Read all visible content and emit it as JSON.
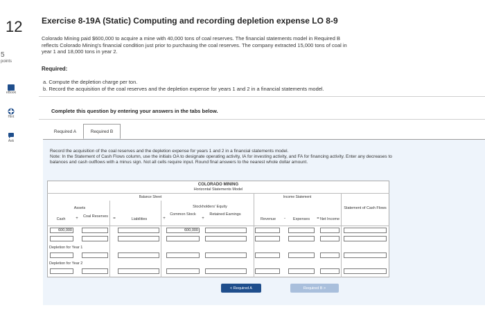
{
  "question": {
    "number": "12",
    "points_value": "5",
    "points_label": "points"
  },
  "sidebar": [
    {
      "label": "eBook",
      "icon": "book-icon"
    },
    {
      "label": "Hint",
      "icon": "hint-icon"
    },
    {
      "label": "Ask",
      "icon": "chat-icon"
    }
  ],
  "header": {
    "title": "Exercise 8-19A (Static) Computing and recording depletion expense LO 8-9"
  },
  "intro": {
    "line1": "Colorado Mining paid $600,000 to acquire a mine with 40,000 tons of coal reserves. The financial statements model in Required B",
    "line2": "reflects Colorado Mining's financial condition just prior to purchasing the coal reserves. The company extracted 15,000 tons of coal in",
    "line3": "year 1 and 18,000 tons in year 2."
  },
  "required": {
    "heading": "Required:",
    "a": "a. Compute the depletion charge per ton.",
    "b": "b. Record the acquisition of the coal reserves and the depletion expense for years 1 and 2 in a financial statements model."
  },
  "complete_note": "Complete this question by entering your answers in the tabs below.",
  "tabs": [
    "Required A",
    "Required B"
  ],
  "instructions": {
    "line1": "Record the acquisition of the coal reserves and the depletion expense for years 1 and 2 in a financial statements model.",
    "line2": "Note: In the Statement of Cash Flows column, use the initials OA to designate operating activity, IA for investing activity, and FA for financing activity. Enter any decreases to",
    "line3": "balances and cash outflows with a minus sign. Not all cells require input. Round final answers to the nearest whole dollar amount."
  },
  "model": {
    "company": "COLORADO MINING",
    "title": "Horizontal Statements Model",
    "balance_sheet": "Balance Sheet",
    "assets": "Assets",
    "cash": "Cash",
    "coal_reserves": "Coal Reserves",
    "liabilities": "Liabilities",
    "stockholders_equity": "Stockholders' Equity",
    "common_stock": "Common Stock",
    "retained_earnings": "Retained Earnings",
    "income_statement": "Income Statement",
    "revenue": "Revenue",
    "expenses": "Expenses",
    "net_income": "Net Income",
    "cash_flows": "Statement of Cash Flows",
    "initial_cash": "600,000",
    "initial_common_stock": "600,000",
    "row_year1": "Depletion for Year 1",
    "row_year2": "Depletion for Year 2",
    "ops": {
      "plus": "+",
      "equals": "=",
      "minus": "-"
    }
  },
  "buttons": {
    "prev": "< Required A",
    "next": "Required B >"
  }
}
